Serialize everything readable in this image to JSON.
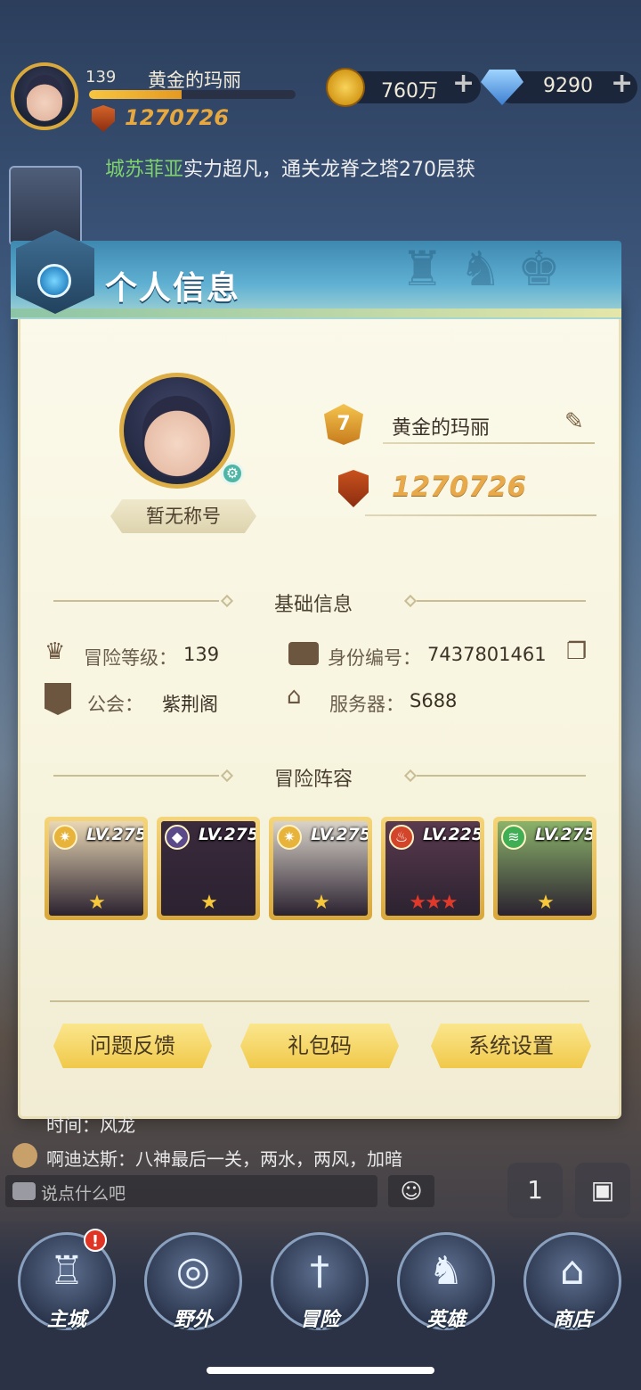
{
  "hud": {
    "level": "139",
    "player_name": "黄金的玛丽",
    "xp_ratio": 0.45,
    "combat_power": "1270726",
    "gold": "760万",
    "gems": "9290",
    "plus": "+",
    "marquee_highlight": "城苏菲亚",
    "marquee_text": "实力超凡，通关龙脊之塔270层获"
  },
  "panel": {
    "title": "个人信息",
    "title_badge": "暂无称号",
    "vip_level": "7",
    "name": "黄金的玛丽",
    "power": "1270726",
    "basic_section": "基础信息",
    "adv_level_label": "冒险等级：",
    "adv_level_value": "139",
    "id_label": "身份编号：",
    "id_value": "7437801461",
    "guild_label": "公会：",
    "guild_value": "紫荆阁",
    "server_label": "服务器：",
    "server_value": "S688",
    "lineup_section": "冒险阵容",
    "heroes": [
      {
        "level": "LV.275",
        "element": "light",
        "stars": "★",
        "star_color": "#f7c93a",
        "bg": "#e9d7b4"
      },
      {
        "level": "LV.275",
        "element": "dark",
        "stars": "★",
        "star_color": "#f7c93a",
        "bg": "#3a2a3c"
      },
      {
        "level": "LV.275",
        "element": "light",
        "stars": "★",
        "star_color": "#f7c93a",
        "bg": "#d9d3c9"
      },
      {
        "level": "LV.225",
        "element": "fire",
        "stars": "★★★",
        "star_color": "#e0392a",
        "bg": "#5a3a4e"
      },
      {
        "level": "LV.275",
        "element": "wind",
        "stars": "★",
        "star_color": "#f7c93a",
        "bg": "#8bb36a"
      }
    ],
    "buttons": {
      "feedback": "问题反馈",
      "gift_code": "礼包码",
      "settings": "系统设置"
    }
  },
  "chat": {
    "line1": "时间：风龙",
    "line2": "啊迪达斯：八神最后一关，两水，两风，加暗",
    "input_placeholder": "说点什么吧"
  },
  "nav": {
    "home": "主城",
    "field": "野外",
    "adventure": "冒险",
    "heroes": "英雄",
    "shop": "商店",
    "home_badge": "!"
  },
  "side": {
    "rank_label": "1"
  },
  "colors": {
    "accent_gold": "#e7a94a",
    "header_blue": "#3e88b0",
    "button_yellow": "#f0c94a"
  }
}
